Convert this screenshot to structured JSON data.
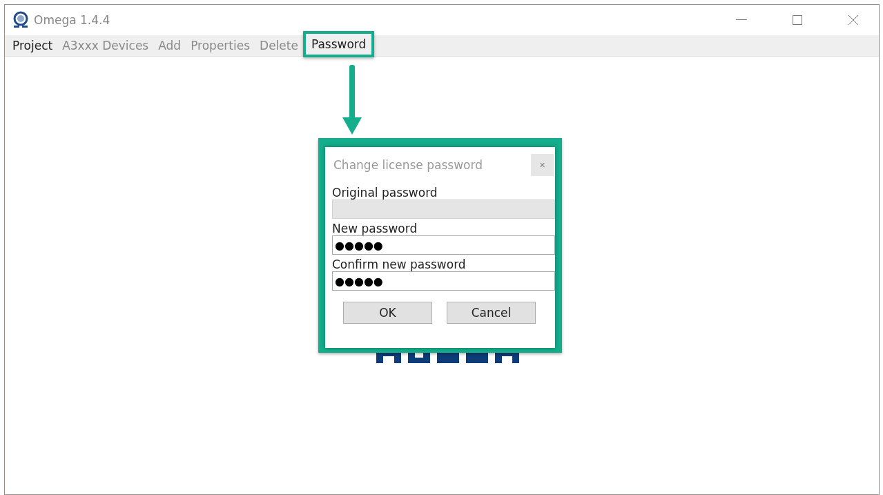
{
  "window": {
    "title": "Omega 1.4.4"
  },
  "menu": [
    {
      "label": "Project",
      "disabled": false,
      "highlighted": false
    },
    {
      "label": "A3xxx Devices",
      "disabled": true,
      "highlighted": false
    },
    {
      "label": "Add",
      "disabled": true,
      "highlighted": false
    },
    {
      "label": "Properties",
      "disabled": true,
      "highlighted": false
    },
    {
      "label": "Delete",
      "disabled": true,
      "highlighted": false
    },
    {
      "label": "Password",
      "disabled": false,
      "highlighted": true
    }
  ],
  "dialog": {
    "title": "Change license password",
    "close": "×",
    "highlighted": true,
    "fields": [
      {
        "label": "Original password",
        "disabled": true
      },
      {
        "label": "New password",
        "value": "●●●●●",
        "disabled": false
      },
      {
        "label": "Confirm new password",
        "value": "●●●●●",
        "disabled": false
      }
    ],
    "buttons": [
      "OK",
      "Cancel"
    ]
  }
}
